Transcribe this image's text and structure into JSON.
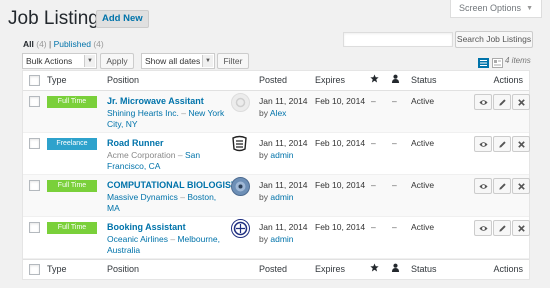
{
  "page": {
    "title": "Job Listings",
    "add_new": "Add New",
    "screen_options": "Screen Options"
  },
  "views": {
    "all_label": "All",
    "all_count": "(4)",
    "published_label": "Published",
    "published_count": "(4)",
    "separator": "|"
  },
  "search": {
    "value": "",
    "button": "Search Job Listings"
  },
  "bulk": {
    "selected": "Bulk Actions",
    "apply": "Apply"
  },
  "dates": {
    "selected": "Show all dates",
    "filter": "Filter"
  },
  "view_modes": {
    "list_icon": "list-view-icon",
    "excerpt_icon": "excerpt-view-icon"
  },
  "items_count": "4 items",
  "columns": {
    "type": "Type",
    "position": "Position",
    "posted": "Posted",
    "expires": "Expires",
    "featured_icon": "star-icon",
    "filled_icon": "user-icon",
    "status": "Status",
    "actions": "Actions"
  },
  "colors": {
    "full_time": "#7ad03a",
    "freelance": "#2ea2cc",
    "link": "#0073aa"
  },
  "rows": [
    {
      "type": "Full Time",
      "title": "Jr. Microwave Assitant",
      "company": "Shining Hearts Inc.",
      "sep": "–",
      "location": "New York City, NY",
      "posted_date": "Jan 11, 2014",
      "by_label": "by",
      "author": "Alex",
      "expires": "Feb 10, 2014",
      "featured": "–",
      "filled": "–",
      "status": "Active"
    },
    {
      "type": "Freelance",
      "title": "Road Runner",
      "company": "Acme Corporation",
      "sep": "–",
      "location": "San Francisco, CA",
      "posted_date": "Jan 11, 2014",
      "by_label": "by",
      "author": "admin",
      "expires": "Feb 10, 2014",
      "featured": "–",
      "filled": "–",
      "status": "Active"
    },
    {
      "type": "Full Time",
      "title": "COMPUTATIONAL BIOLOGIST",
      "company": "Massive Dynamics",
      "sep": "–",
      "location": "Boston, MA",
      "posted_date": "Jan 11, 2014",
      "by_label": "by",
      "author": "admin",
      "expires": "Feb 10, 2014",
      "featured": "–",
      "filled": "–",
      "status": "Active"
    },
    {
      "type": "Full Time",
      "title": "Booking Assistant",
      "company": "Oceanic Airlines",
      "sep": "–",
      "location": "Melbourne, Australia",
      "posted_date": "Jan 11, 2014",
      "by_label": "by",
      "author": "admin",
      "expires": "Feb 10, 2014",
      "featured": "–",
      "filled": "–",
      "status": "Active"
    }
  ],
  "row_actions": {
    "view_icon": "eye-icon",
    "edit_icon": "pencil-icon",
    "delete_icon": "close-icon"
  }
}
